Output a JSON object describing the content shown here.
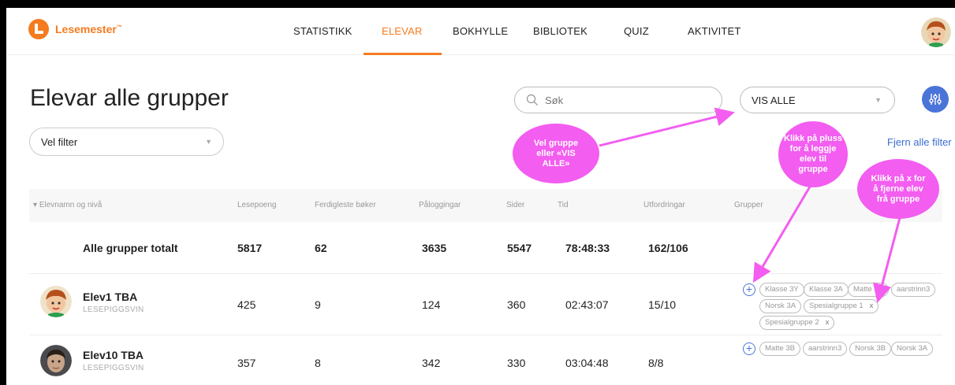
{
  "app": {
    "name": "Lesemester",
    "trademark": "™"
  },
  "nav": {
    "items": [
      {
        "label": "STATISTIKK",
        "active": false
      },
      {
        "label": "ELEVAR",
        "active": true
      },
      {
        "label": "BOKHYLLE",
        "active": false
      },
      {
        "label": "BIBLIOTEK",
        "active": false
      },
      {
        "label": "QUIZ",
        "active": false
      },
      {
        "label": "AKTIVITET",
        "active": false
      }
    ]
  },
  "page": {
    "title": "Elevar alle grupper",
    "filter_select": "Vel filter",
    "search_placeholder": "Søk",
    "group_select": "VIS ALLE",
    "clear_filters": "Fjern alle filter"
  },
  "table": {
    "headers": [
      "Elevnamn og nivå",
      "Lesepoeng",
      "Ferdigleste bøker",
      "Påloggingar",
      "Sider",
      "Tid",
      "Utfordringar",
      "Grupper"
    ],
    "totals": {
      "label": "Alle grupper totalt",
      "values": [
        "5817",
        "62",
        "3635",
        "5547",
        "78:48:33",
        "162/106"
      ]
    },
    "rows": [
      {
        "name": "Elev1 TBA",
        "level": "LESEPIGGSVIN",
        "values": [
          "425",
          "9",
          "124",
          "360",
          "02:43:07",
          "15/10"
        ],
        "groups": [
          {
            "label": "Klasse 3Y",
            "removable": false
          },
          {
            "label": "Klasse 3A",
            "removable": false
          },
          {
            "label": "Matte 3A",
            "removable": false
          },
          {
            "label": "aarstrinn3",
            "removable": false
          },
          {
            "label": "Norsk 3A",
            "removable": false
          },
          {
            "label": "Spesialgruppe 1",
            "removable": true
          },
          {
            "label": "Spesialgruppe 2",
            "removable": true
          }
        ]
      },
      {
        "name": "Elev10 TBA",
        "level": "LESEPIGGSVIN",
        "values": [
          "357",
          "8",
          "342",
          "330",
          "03:04:48",
          "8/8"
        ],
        "groups": [
          {
            "label": "Matte 3B",
            "removable": false
          },
          {
            "label": "aarstrinn3",
            "removable": false
          },
          {
            "label": "Norsk 3B",
            "removable": false
          },
          {
            "label": "Norsk 3A",
            "removable": false
          }
        ]
      }
    ],
    "remove_symbol": "x",
    "add_symbol": "+"
  },
  "annotations": {
    "select_group": "Vel gruppe eller «VIS ALLE»",
    "add_to_group": "Klikk på pluss for å leggje elev til gruppe",
    "remove_from_group": "Klikk på x for å fjerne elev frå gruppe",
    "color": "#f35df0"
  },
  "colors": {
    "accent": "#f47b20",
    "link": "#3a6ed1",
    "button": "#4a74d8"
  }
}
